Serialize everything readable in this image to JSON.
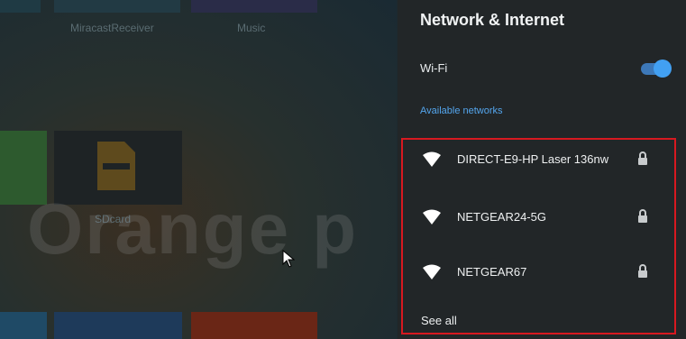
{
  "background": {
    "tiles": [
      {
        "label": "MiracastReceiver"
      },
      {
        "label": "Music"
      },
      {
        "label": "SDcard"
      }
    ],
    "brand_text": "Orange p"
  },
  "panel": {
    "title": "Network & Internet",
    "wifi": {
      "label": "Wi-Fi",
      "enabled": true
    },
    "available_networks_header": "Available networks",
    "networks": [
      {
        "ssid": "DIRECT-E9-HP Laser 136nw",
        "secured": true,
        "icon": "wifi-icon"
      },
      {
        "ssid": "NETGEAR24-5G",
        "secured": true,
        "icon": "wifi-icon"
      },
      {
        "ssid": "NETGEAR67",
        "secured": true,
        "icon": "wifi-icon"
      }
    ],
    "see_all": "See all",
    "colors": {
      "accent": "#42a0f2",
      "highlight_border": "#d71920",
      "panel_bg": "#222628"
    }
  }
}
